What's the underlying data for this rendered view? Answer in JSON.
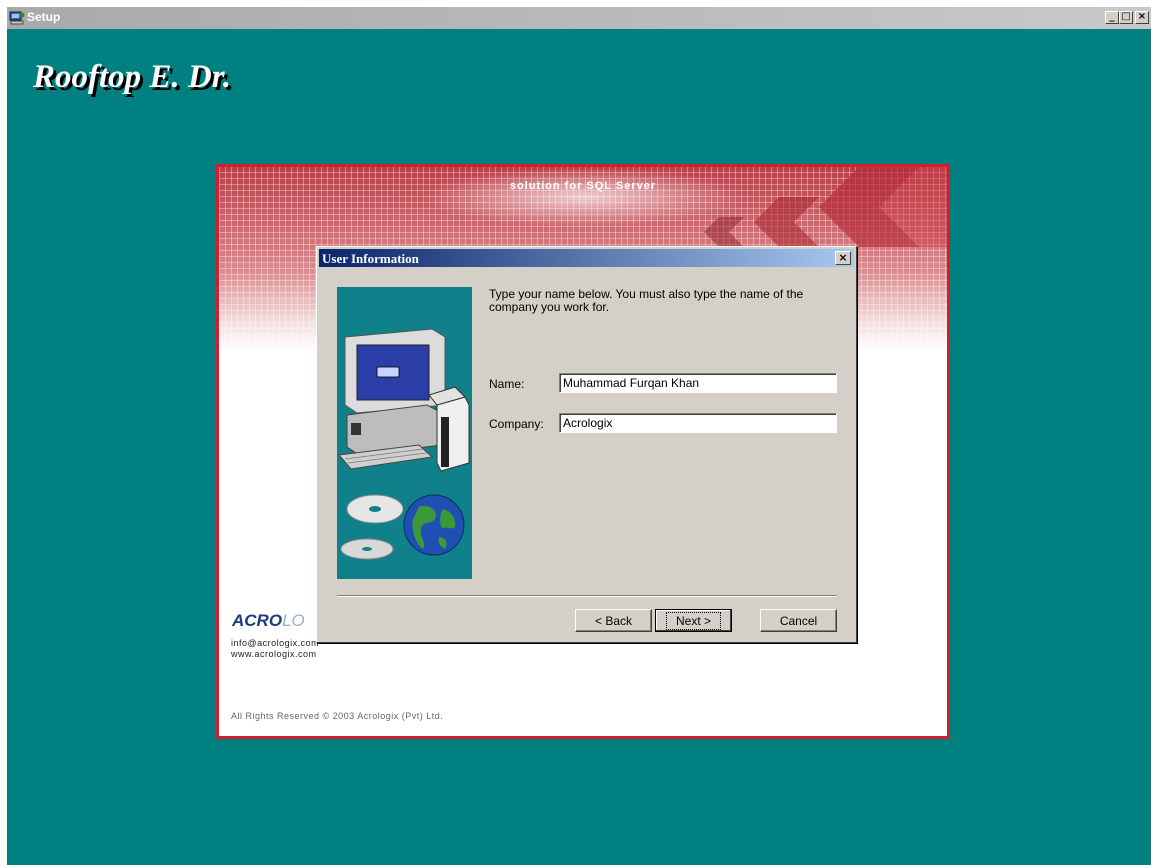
{
  "window": {
    "title": "Setup",
    "controls": {
      "minimize": "_",
      "maximize": "□",
      "close": "×"
    }
  },
  "app_title": "Rooftop E. Dr.",
  "splash": {
    "tagline": "solution for SQL Server",
    "logo_bold": "ACRO",
    "logo_light": "LO",
    "email": "info@acrologix.com",
    "website": "www.acrologix.com",
    "copyright": "All Rights Reserved © 2003 Acrologix (Pvt) Ltd."
  },
  "dialog": {
    "title": "User Information",
    "close_label": "×",
    "instructions": "Type your name below. You must also type the name of the company you work for.",
    "name_label": "Name:",
    "name_value": "Muhammad Furqan Khan",
    "company_label": "Company:",
    "company_value": "Acrologix",
    "buttons": {
      "back": "< Back",
      "next": "Next >",
      "cancel": "Cancel"
    }
  },
  "colors": {
    "desktop": "#008080",
    "splash_border": "#d21e2e",
    "dialog_face": "#d4d0c8",
    "title_gradient_start": "#0a246a",
    "title_gradient_end": "#a6caf0"
  },
  "icons": [
    "setup-app-icon",
    "computer-illustration",
    "cd-discs-illustration",
    "globe-illustration"
  ]
}
